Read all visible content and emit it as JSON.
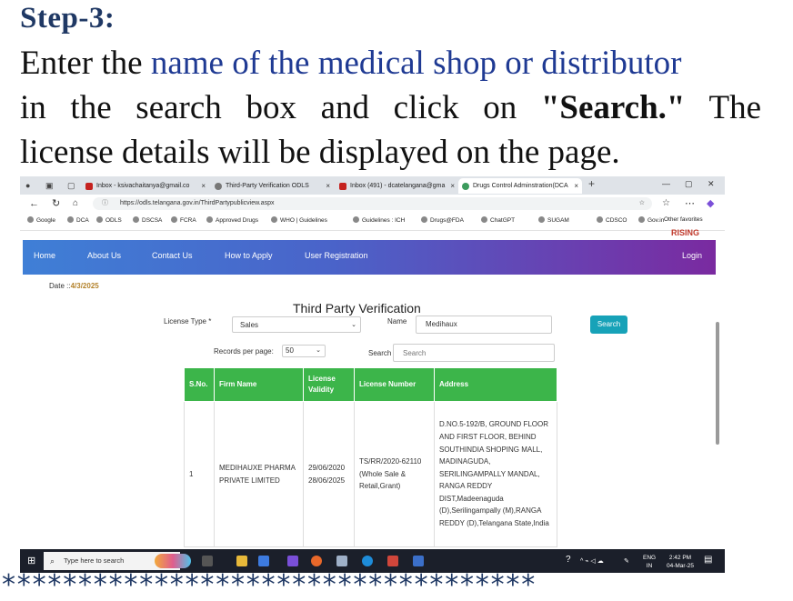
{
  "slide": {
    "title": "Step-3:",
    "line1_a": "Enter the ",
    "line1_b": "name of the medical shop or distributor",
    "line2_a": "in the search box and click on ",
    "line2_b": "\"Search.\"",
    "line2_c": " The",
    "line3": "license details will be displayed on the page.",
    "stars": "***********************************"
  },
  "browser": {
    "tabs": [
      {
        "label": "Inbox - ksivachaitanya@gmail.co",
        "color": "#c5221f"
      },
      {
        "label": "Third-Party Verification ODLS",
        "color": "#777777"
      },
      {
        "label": "Inbox (491) - dcatelangana@gma",
        "color": "#c5221f"
      },
      {
        "label": "Drugs Control Adminstration(DCA",
        "color": "#3c9b5d"
      }
    ],
    "url": "https://odls.telangana.gov.in/ThirdPartypublicview.aspx",
    "bookmarks": [
      "Google",
      "DCA",
      "ODLS",
      "DSCSA",
      "FCRA",
      "Approved Drugs",
      "WHO | Guidelines",
      "Guidelines : ICH",
      "Drugs@FDA",
      "ChatGPT",
      "SUGAM",
      "CDSCO",
      "Gov.in"
    ],
    "other_favorites": "Other favorites"
  },
  "site": {
    "rising": "RISING",
    "nav": [
      "Home",
      "About Us",
      "Contact Us",
      "How to Apply",
      "User Registration"
    ],
    "login": "Login",
    "date_label": "Date ::",
    "date_value": "4/3/2025",
    "page_title": "Third Party Verification",
    "license_type_label": "License Type *",
    "license_type_value": "Sales",
    "name_label": "Name",
    "name_value": "Medihaux",
    "search_button": "Search",
    "records_label": "Records per page:",
    "records_value": "50",
    "search_label": "Search",
    "search_placeholder": "Search",
    "table": {
      "headers": [
        "S.No.",
        "Firm Name",
        "License Validity",
        "License Number",
        "Address"
      ],
      "rows": [
        {
          "sno": "1",
          "firm": "MEDIHAUXE PHARMA PRIVATE LIMITED",
          "validity": "29/06/2020 28/06/2025",
          "license": "TS/RR/2020-62110 (Whole Sale & Retail,Grant)",
          "address": "D.NO.5-192/B, GROUND FLOOR AND FIRST FLOOR, BEHIND SOUTHINDIA SHOPING MALL, MADINAGUDA, SERILINGAMPALLY MANDAL, RANGA REDDY DIST,Madeenaguda (D),Serilingampally (M),RANGA REDDY (D),Telangana State,India"
        }
      ]
    }
  },
  "taskbar": {
    "search_placeholder": "Type here to search",
    "lang_top": "ENG",
    "lang_bottom": "IN",
    "time": "2:42 PM",
    "date": "04-Mar-25"
  },
  "colors": {
    "title": "#1f3864",
    "highlight": "#1f3a93",
    "table_header": "#3cb54a",
    "search_button": "#17a2b8"
  }
}
